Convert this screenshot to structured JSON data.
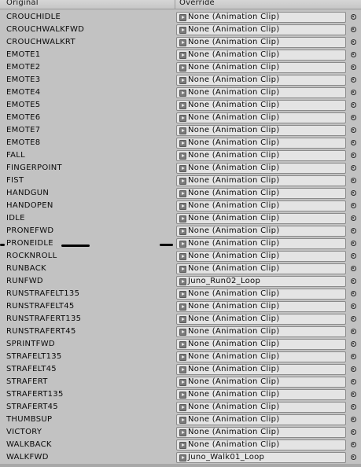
{
  "header": {
    "original_label": "Original",
    "override_label": "Override"
  },
  "icons": {
    "clip": "animation-clip-icon",
    "picker": "object-picker-icon"
  },
  "colors": {
    "panel_bg": "#c2c2c2",
    "field_bg": "#e4e4e4"
  },
  "rows": [
    {
      "original": "CROUCHIDLE",
      "override": "None (Animation Clip)"
    },
    {
      "original": "CROUCHWALKFWD",
      "override": "None (Animation Clip)"
    },
    {
      "original": "CROUCHWALKRT",
      "override": "None (Animation Clip)"
    },
    {
      "original": "EMOTE1",
      "override": "None (Animation Clip)"
    },
    {
      "original": "EMOTE2",
      "override": "None (Animation Clip)"
    },
    {
      "original": "EMOTE3",
      "override": "None (Animation Clip)"
    },
    {
      "original": "EMOTE4",
      "override": "None (Animation Clip)"
    },
    {
      "original": "EMOTE5",
      "override": "None (Animation Clip)"
    },
    {
      "original": "EMOTE6",
      "override": "None (Animation Clip)"
    },
    {
      "original": "EMOTE7",
      "override": "None (Animation Clip)"
    },
    {
      "original": "EMOTE8",
      "override": "None (Animation Clip)"
    },
    {
      "original": "FALL",
      "override": "None (Animation Clip)"
    },
    {
      "original": "FINGERPOINT",
      "override": "None (Animation Clip)"
    },
    {
      "original": "FIST",
      "override": "None (Animation Clip)"
    },
    {
      "original": "HANDGUN",
      "override": "None (Animation Clip)"
    },
    {
      "original": "HANDOPEN",
      "override": "None (Animation Clip)"
    },
    {
      "original": "IDLE",
      "override": "None (Animation Clip)"
    },
    {
      "original": "PRONEFWD",
      "override": "None (Animation Clip)"
    },
    {
      "original": "PRONEIDLE",
      "override": "None (Animation Clip)"
    },
    {
      "original": "ROCKNROLL",
      "override": "None (Animation Clip)"
    },
    {
      "original": "RUNBACK",
      "override": "None (Animation Clip)"
    },
    {
      "original": "RUNFWD",
      "override": "Juno_Run02_Loop"
    },
    {
      "original": "RUNSTRAFELT135",
      "override": "None (Animation Clip)"
    },
    {
      "original": "RUNSTRAFELT45",
      "override": "None (Animation Clip)"
    },
    {
      "original": "RUNSTRAFERT135",
      "override": "None (Animation Clip)"
    },
    {
      "original": "RUNSTRAFERT45",
      "override": "None (Animation Clip)"
    },
    {
      "original": "SPRINTFWD",
      "override": "None (Animation Clip)"
    },
    {
      "original": "STRAFELT135",
      "override": "None (Animation Clip)"
    },
    {
      "original": "STRAFELT45",
      "override": "None (Animation Clip)"
    },
    {
      "original": "STRAFERT",
      "override": "None (Animation Clip)"
    },
    {
      "original": "STRAFERT135",
      "override": "None (Animation Clip)"
    },
    {
      "original": "STRAFERT45",
      "override": "None (Animation Clip)"
    },
    {
      "original": "THUMBSUP",
      "override": "None (Animation Clip)"
    },
    {
      "original": "VICTORY",
      "override": "None (Animation Clip)"
    },
    {
      "original": "WALKBACK",
      "override": "None (Animation Clip)"
    },
    {
      "original": "WALKFWD",
      "override": "Juno_Walk01_Loop"
    }
  ]
}
